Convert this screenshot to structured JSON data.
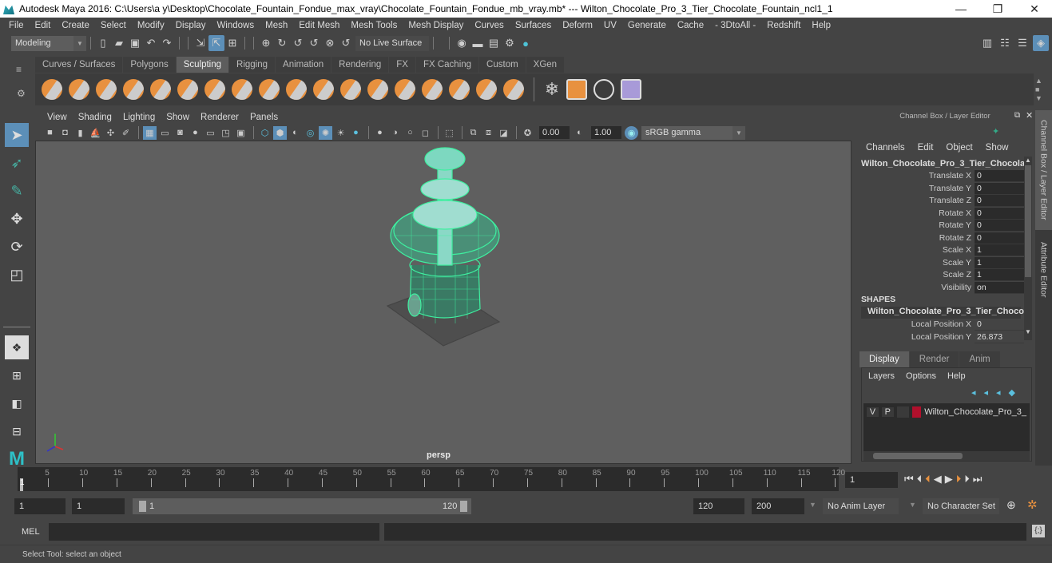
{
  "window": {
    "title": "Autodesk Maya 2016: C:\\Users\\a y\\Desktop\\Chocolate_Fountain_Fondue_max_vray\\Chocolate_Fountain_Fondue_mb_vray.mb*   ---   Wilton_Chocolate_Pro_3_Tier_Chocolate_Fountain_ncl1_1",
    "minimize": "—",
    "restore": "❐",
    "close": "✕"
  },
  "menubar": [
    "File",
    "Edit",
    "Create",
    "Select",
    "Modify",
    "Display",
    "Windows",
    "Mesh",
    "Edit Mesh",
    "Mesh Tools",
    "Mesh Display",
    "Curves",
    "Surfaces",
    "Deform",
    "UV",
    "Generate",
    "Cache",
    "- 3DtoAll -",
    "Redshift",
    "Help"
  ],
  "statusline": {
    "mode": "Modeling",
    "live_surface": "No Live Surface"
  },
  "shelf": {
    "tabs": [
      "Curves / Surfaces",
      "Polygons",
      "Sculpting",
      "Rigging",
      "Animation",
      "Rendering",
      "FX",
      "FX Caching",
      "Custom",
      "XGen"
    ],
    "active_tab": "Sculpting",
    "sculpt_tools": [
      "sculpt",
      "smooth",
      "relax",
      "grab",
      "pinch",
      "flatten",
      "foamy",
      "spray",
      "repeat",
      "imprint",
      "wax",
      "scrape",
      "fill",
      "knife",
      "smear",
      "bulge",
      "amplify",
      "freeze"
    ]
  },
  "viewport": {
    "menu": [
      "View",
      "Shading",
      "Lighting",
      "Show",
      "Renderer",
      "Panels"
    ],
    "exposure": "0.00",
    "gamma": "1.00",
    "color_space": "sRGB gamma",
    "camera_label": "persp",
    "axis": {
      "x": "x",
      "y": "y",
      "z": "z"
    },
    "wireframe_color": "#3ef0a0"
  },
  "channel_box": {
    "title": "Channel Box / Layer Editor",
    "menu": [
      "Channels",
      "Edit",
      "Object",
      "Show"
    ],
    "object_name": "Wilton_Chocolate_Pro_3_Tier_Chocola...",
    "channels": [
      {
        "label": "Translate X",
        "value": "0"
      },
      {
        "label": "Translate Y",
        "value": "0"
      },
      {
        "label": "Translate Z",
        "value": "0"
      },
      {
        "label": "Rotate X",
        "value": "0"
      },
      {
        "label": "Rotate Y",
        "value": "0"
      },
      {
        "label": "Rotate Z",
        "value": "0"
      },
      {
        "label": "Scale X",
        "value": "1"
      },
      {
        "label": "Scale Y",
        "value": "1"
      },
      {
        "label": "Scale Z",
        "value": "1"
      },
      {
        "label": "Visibility",
        "value": "on"
      }
    ],
    "shapes_header": "SHAPES",
    "shape_name": "Wilton_Chocolate_Pro_3_Tier_Choco...",
    "shape_channels": [
      {
        "label": "Local Position X",
        "value": "0"
      },
      {
        "label": "Local Position Y",
        "value": "26.873"
      }
    ]
  },
  "layer_editor": {
    "tabs": [
      "Display",
      "Render",
      "Anim"
    ],
    "active_tab": "Display",
    "menu": [
      "Layers",
      "Options",
      "Help"
    ],
    "layers": [
      {
        "v": "V",
        "p": "P",
        "color": "#b0102c",
        "name": "Wilton_Chocolate_Pro_3_"
      }
    ]
  },
  "side_tabs": [
    "Channel Box / Layer Editor",
    "Attribute Editor"
  ],
  "timeline": {
    "ticks": [
      5,
      10,
      15,
      20,
      25,
      30,
      35,
      40,
      45,
      50,
      55,
      60,
      65,
      70,
      75,
      80,
      85,
      90,
      95,
      100,
      105,
      110,
      115,
      120
    ],
    "start_marker": "1",
    "current_frame": "1",
    "range_start": "1",
    "playback_start": "1",
    "slider_min": "1",
    "slider_max": "120",
    "range_end": "120",
    "playback_end": "200",
    "anim_layer": "No Anim Layer",
    "character_set": "No Character Set"
  },
  "command_line": {
    "label": "MEL",
    "input": "",
    "result": ""
  },
  "help_line": "Select Tool: select an object"
}
